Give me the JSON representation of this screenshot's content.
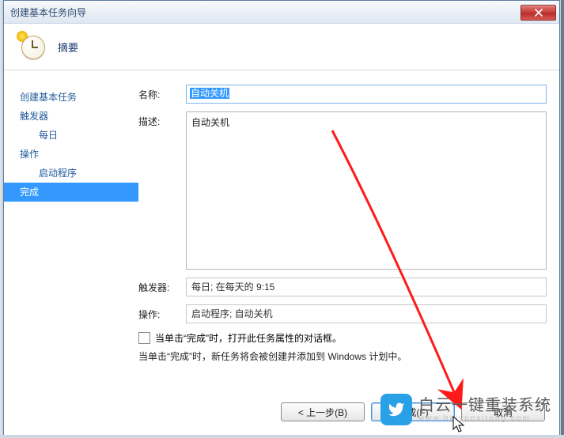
{
  "window": {
    "title": "创建基本任务向导"
  },
  "header": {
    "title": "摘要"
  },
  "sidebar": {
    "items": [
      {
        "label": "创建基本任务",
        "indent": false,
        "selected": false
      },
      {
        "label": "触发器",
        "indent": false,
        "selected": false
      },
      {
        "label": "每日",
        "indent": true,
        "selected": false
      },
      {
        "label": "操作",
        "indent": false,
        "selected": false
      },
      {
        "label": "启动程序",
        "indent": true,
        "selected": false
      },
      {
        "label": "完成",
        "indent": false,
        "selected": true
      }
    ]
  },
  "form": {
    "name_label": "名称:",
    "name_value": "自动关机",
    "desc_label": "描述:",
    "desc_value": "自动关机",
    "trigger_label": "触发器:",
    "trigger_value": "每日; 在每天的 9:15",
    "action_label": "操作:",
    "action_value": "启动程序; 自动关机",
    "checkbox_label": "当单击“完成”时，打开此任务属性的对话框。",
    "note_text": "当单击“完成”时，新任务将会被创建并添加到 Windows 计划中。"
  },
  "footer": {
    "back_label": "< 上一步(B)",
    "finish_label": "完成(F)",
    "cancel_label": "取消"
  },
  "watermark": {
    "line1": "白云一键重装系统",
    "line2": "www.baiyunxitong.com"
  }
}
